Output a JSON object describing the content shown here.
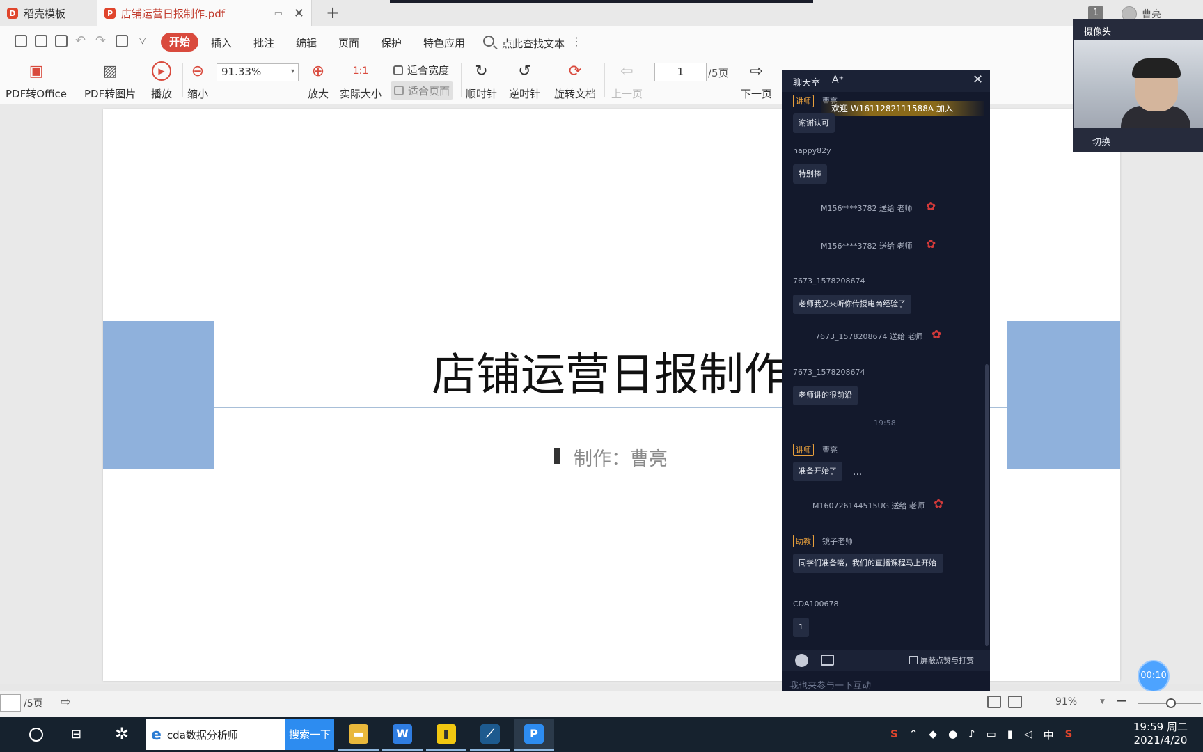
{
  "tabs": [
    {
      "label": "稻壳模板"
    },
    {
      "label": "店铺运营日报制作.pdf"
    }
  ],
  "account": {
    "window_count": "1",
    "user_name": "曹亮"
  },
  "menu": {
    "start": "开始",
    "items": [
      "插入",
      "批注",
      "编辑",
      "页面",
      "保护",
      "特色应用"
    ],
    "search_placeholder": "点此查找文本"
  },
  "ribbon": {
    "pdf_to_office": "PDF转Office",
    "pdf_to_image": "PDF转图片",
    "play": "播放",
    "zoom_out": "缩小",
    "zoom_value": "91.33%",
    "zoom_in": "放大",
    "actual_size": "实际大小",
    "fit_width": "适合宽度",
    "fit_page": "适合页面",
    "rotate_cw": "顺时针",
    "rotate_ccw": "逆时针",
    "rotate_doc": "旋转文档",
    "prev_page": "上一页",
    "page_current": "1",
    "page_total": "/5页",
    "next_page": "下一页"
  },
  "document": {
    "title": "店铺运营日报制作",
    "subtitle": "制作：曹亮"
  },
  "chat": {
    "title": "聊天室",
    "font_toggle": "A⁺",
    "welcome": "欢迎 W1611282111588A 加入",
    "messages": {
      "m1_role": "讲师",
      "m1_user": "曹亮",
      "m1_text": "谢谢认可",
      "m2_user": "happy82y",
      "m2_text": "特别棒",
      "g1": "M156****3782 送给 老师",
      "g2": "M156****3782 送给 老师",
      "m3_user": "7673_1578208674",
      "m3_text": "老师我又来听你传授电商经验了",
      "g3": "7673_1578208674 送给 老师",
      "m4_user": "7673_1578208674",
      "m4_text": "老师讲的很前沿",
      "time": "19:58",
      "m5_role": "讲师",
      "m5_user": "曹亮",
      "m5_text": "准备开始了",
      "m5_more": "...",
      "g4": "M160726144515UG 送给 老师",
      "m6_role": "助教",
      "m6_user": "镜子老师",
      "m6_text": "同学们准备喽，我们的直播课程马上开始",
      "m7_user": "CDA100678",
      "m7_text": "1"
    },
    "block_label": "屏蔽点赞与打赏",
    "input_placeholder": "我也来参与一下互动"
  },
  "camera": {
    "title": "摄像头",
    "switch": "切换"
  },
  "timer": "00:10",
  "status": {
    "page_total": "/5页",
    "zoom": "91%"
  },
  "taskbar": {
    "search_text": "cda数据分析师",
    "search_button": "搜索一下",
    "ime": "中",
    "time": "19:59 周二",
    "date": "2021/4/20"
  },
  "colors": {
    "accent": "#d94a3d",
    "chat_bg": "#13192c",
    "slide_blue": "#8fb1dc",
    "taskbar": "#16222e"
  }
}
